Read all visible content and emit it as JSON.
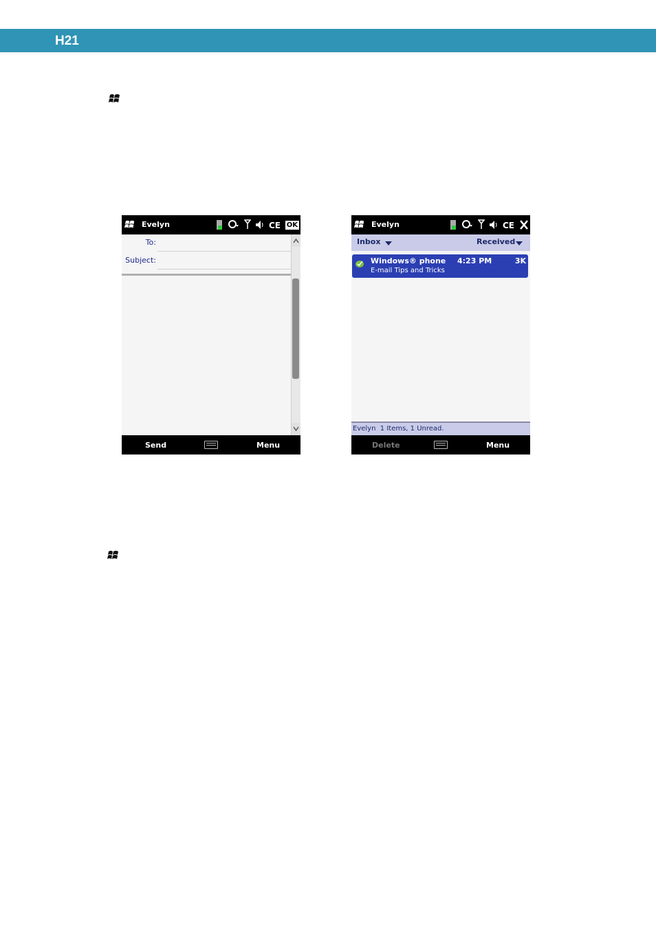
{
  "page": {
    "header_title": "H21"
  },
  "compose_screen": {
    "status": {
      "title": "Evelyn",
      "ok_label": "OK"
    },
    "fields": [
      {
        "label": "To:",
        "value": ""
      },
      {
        "label": "Subject:",
        "value": ""
      }
    ],
    "softkeys": {
      "left": "Send",
      "right": "Menu"
    }
  },
  "inbox_screen": {
    "status": {
      "title": "Evelyn"
    },
    "list_header": {
      "folder": "Inbox",
      "sort": "Received"
    },
    "messages": [
      {
        "from": "Windows® phone",
        "time": "4:23 PM",
        "size": "3K",
        "subject": "E-mail Tips and Tricks"
      }
    ],
    "status_strip": "Evelyn  1 Items, 1 Unread.",
    "softkeys": {
      "left": "Delete",
      "right": "Menu"
    }
  },
  "colors": {
    "header_bar": "#2f94b5",
    "selection": "#2b3fb3",
    "list_header": "#c9cbe8"
  }
}
